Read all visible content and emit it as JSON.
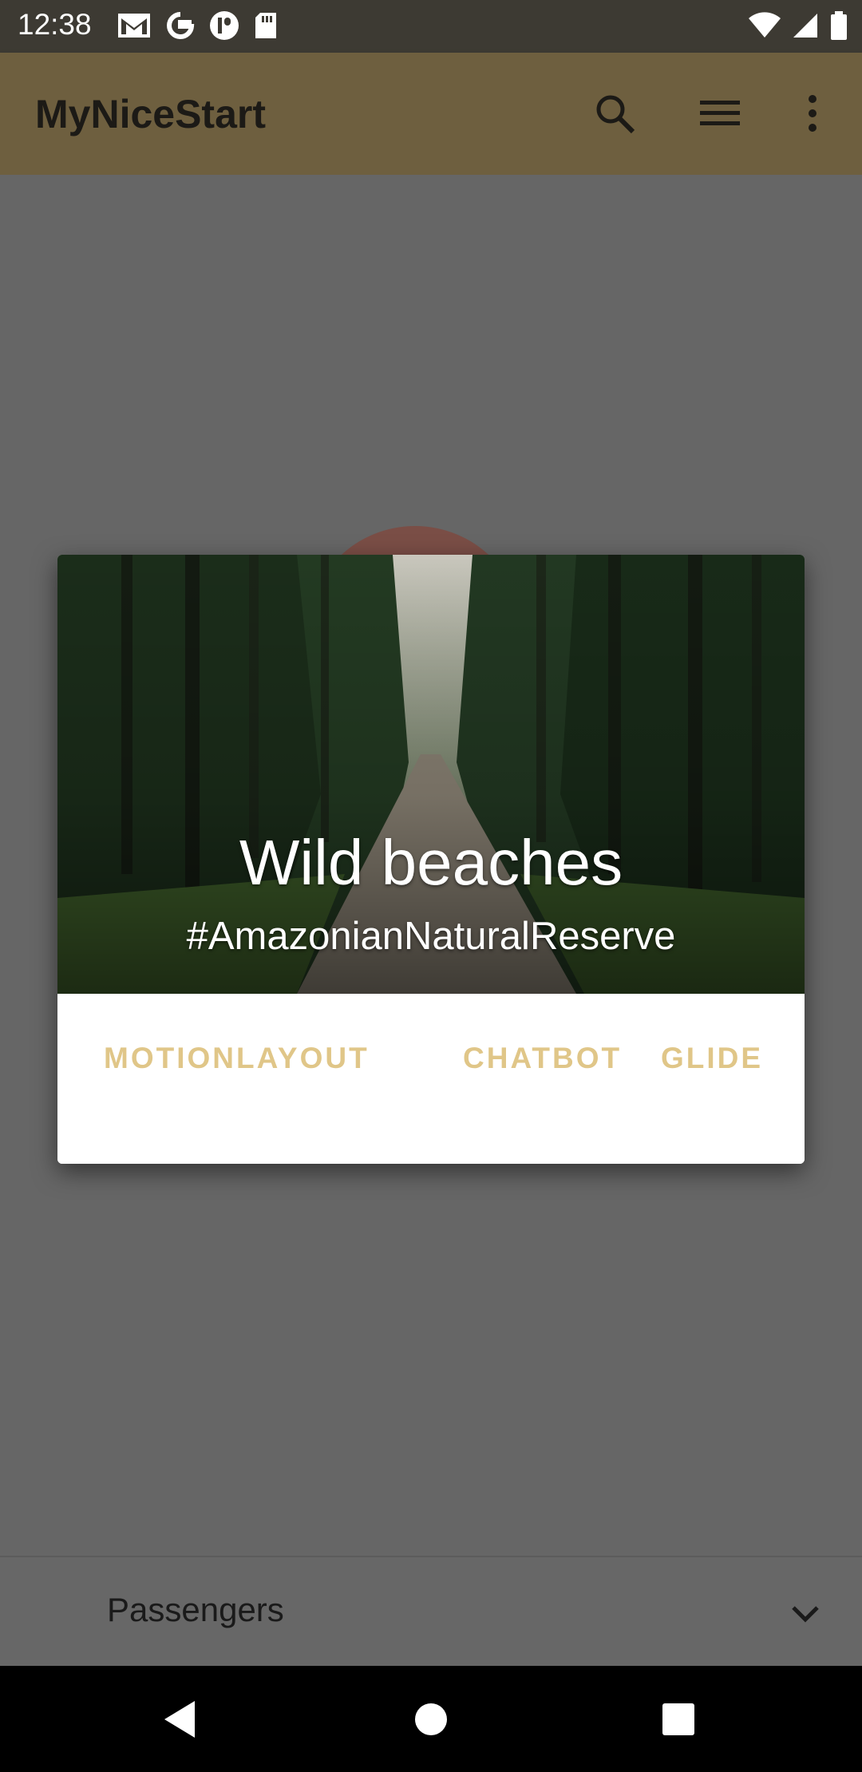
{
  "status_bar": {
    "time": "12:38",
    "left_icons": [
      "gmail-icon",
      "google-icon",
      "app-icon",
      "sd-card-icon"
    ],
    "right_icons": [
      "wifi-icon",
      "signal-icon",
      "battery-icon"
    ]
  },
  "app_bar": {
    "title": "MyNiceStart",
    "actions": [
      "search-icon",
      "menu-icon",
      "more-vert-icon"
    ]
  },
  "dialog": {
    "title": "Wild beaches",
    "subtitle": "#AmazonianNaturalReserve",
    "actions": {
      "motionlayout": "MOTIONLAYOUT",
      "chatbot": "CHATBOT",
      "glide": "GLIDE"
    },
    "action_color": "#e0c688"
  },
  "bottom_selector": {
    "label": "Passengers"
  },
  "nav_bar": {
    "buttons": [
      "back-icon",
      "home-icon",
      "recents-icon"
    ]
  },
  "colors": {
    "app_bar": "#6e5f3f",
    "scrim": "#666666",
    "status_bar": "#3d3a33"
  }
}
